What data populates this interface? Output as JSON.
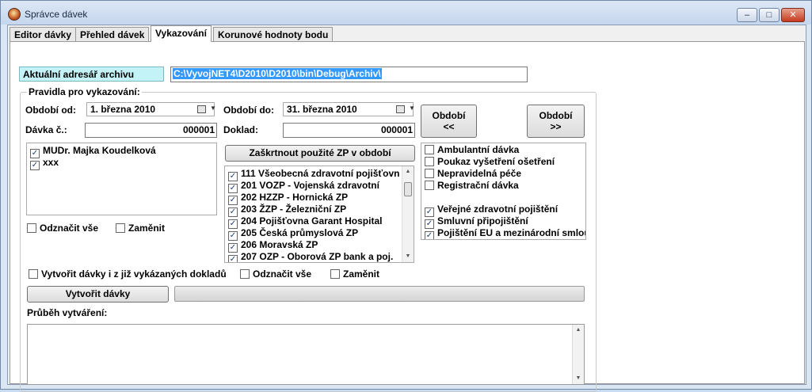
{
  "window": {
    "title": "Správce dávek"
  },
  "tabs": [
    "Editor dávky",
    "Přehled dávek",
    "Vykazování",
    "Korunové hodnoty bodu"
  ],
  "archive": {
    "label": "Aktuální adresář archivu",
    "path": "C:\\VyvojNET4\\D2010\\D2010\\bin\\Debug\\Archiv\\"
  },
  "rules": {
    "title": "Pravidla pro vykazování:",
    "period_from_label": "Období od:",
    "period_from": "1.  března  2010",
    "period_to_label": "Období do:",
    "period_to": "31.  března  2010",
    "batch_no_label": "Dávka č.:",
    "batch_no": "000001",
    "doc_label": "Doklad:",
    "doc_no": "000001",
    "btn_prev_line1": "Období",
    "btn_prev_line2": "<<",
    "btn_next_line1": "Období",
    "btn_next_line2": ">>",
    "check_used_btn": "Zaškrtnout použité ZP v období"
  },
  "doctors": [
    "MUDr. Majka Koudelková",
    "xxx"
  ],
  "doctor_actions": {
    "uncheck_all": "Odznačit vše",
    "swap": "Zaměnit"
  },
  "insurers": [
    "111 Všeobecná zdravotní pojišťovn",
    "201 VOZP - Vojenská zdravotní",
    "202 HZZP - Hornická ZP",
    "203 ŽZP - Železniční ZP",
    "204 Pojišťovna Garant Hospital",
    "205 Česká průmyslová ZP",
    "206 Moravská ZP",
    "207 OZP - Oborová ZP bank a poj."
  ],
  "batch_types": [
    "Ambulantní dávka",
    "Poukaz vyšetření ošetření",
    "Nepravidelná péče",
    "Registrační dávka"
  ],
  "insurance_types": [
    "Veřejné zdravotní pojištění",
    "Smluvní připojištění",
    "Pojištění EU a mezinárodní smlou"
  ],
  "bottom": {
    "create_also_label": "Vytvořit dávky i z již vykázaných dokladů",
    "uncheck_all": "Odznačit vše",
    "swap": "Zaměnit",
    "create_btn": "Vytvořit dávky",
    "progress_label": "Průběh vytváření:"
  }
}
